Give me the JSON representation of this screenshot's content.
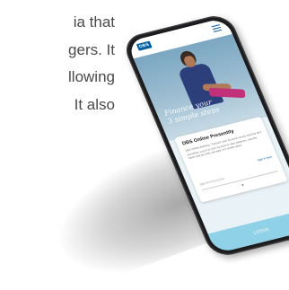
{
  "background_text": {
    "lines": [
      "ia that",
      "gers. It",
      "llowing",
      "It also"
    ]
  },
  "phone_screen": {
    "logo": "DBS",
    "menu_icon": "hamburger-menu-icon",
    "hero_caption_line1": "Finance your",
    "hero_caption_line2": "3 simple steps",
    "card": {
      "title": "DBS Online Presentity",
      "body": "DBS Online Banking. Transact your accounts easily anytime and anywhere. Log in to your account to view balances, transfer funds and pay bills securely in 3 simple steps.",
      "link": "Sign in here",
      "input_placeholder": "DBS NOTIFICATION"
    },
    "button_label": "LOGIN"
  },
  "colors": {
    "brand_blue": "#005aa0",
    "button": "#8fd1e6",
    "accent_magenta": "#c2307a"
  }
}
